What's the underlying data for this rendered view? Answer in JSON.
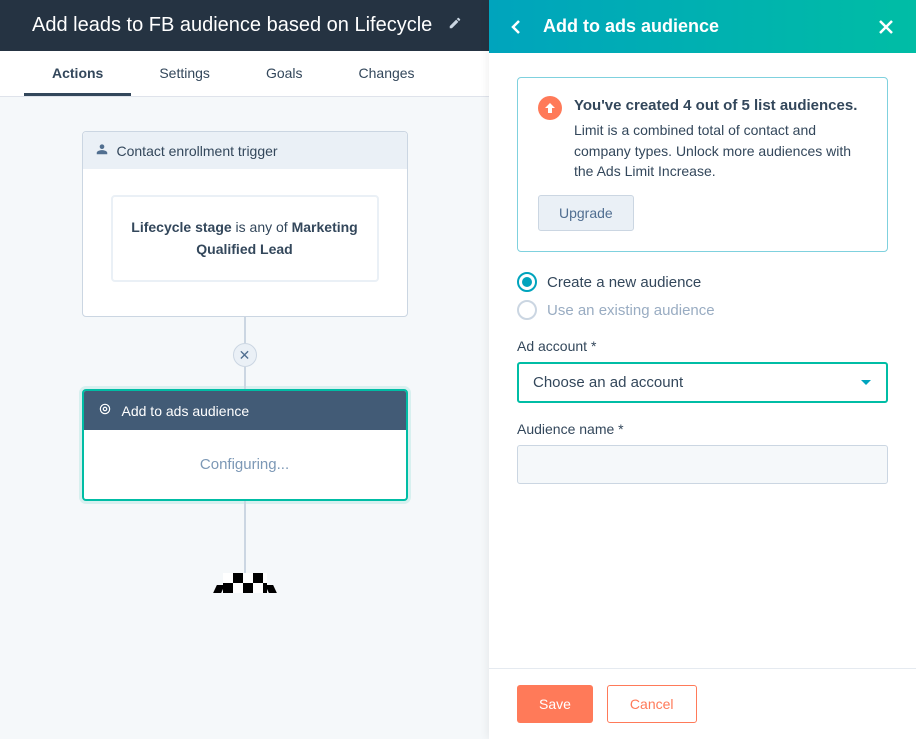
{
  "header": {
    "title": "Add leads to FB audience based on Lifecycle"
  },
  "tabs": [
    {
      "label": "Actions",
      "active": true
    },
    {
      "label": "Settings",
      "active": false
    },
    {
      "label": "Goals",
      "active": false
    },
    {
      "label": "Changes",
      "active": false
    }
  ],
  "trigger": {
    "head": "Contact enrollment trigger",
    "prop": "Lifecycle stage",
    "verb": " is any of ",
    "value": "Marketing Qualified Lead"
  },
  "action_card": {
    "head": "Add to ads audience",
    "body": "Configuring..."
  },
  "panel": {
    "title": "Add to ads audience",
    "notice": {
      "heading": "You've created 4 out of 5 list audiences.",
      "body": "Limit is a combined total of contact and company types. Unlock more audiences with the Ads Limit Increase.",
      "button": "Upgrade"
    },
    "radios": {
      "create": "Create a new audience",
      "existing": "Use an existing audience"
    },
    "ad_account": {
      "label": "Ad account *",
      "placeholder": "Choose an ad account"
    },
    "audience_name": {
      "label": "Audience name *",
      "value": ""
    },
    "footer": {
      "save": "Save",
      "cancel": "Cancel"
    }
  }
}
